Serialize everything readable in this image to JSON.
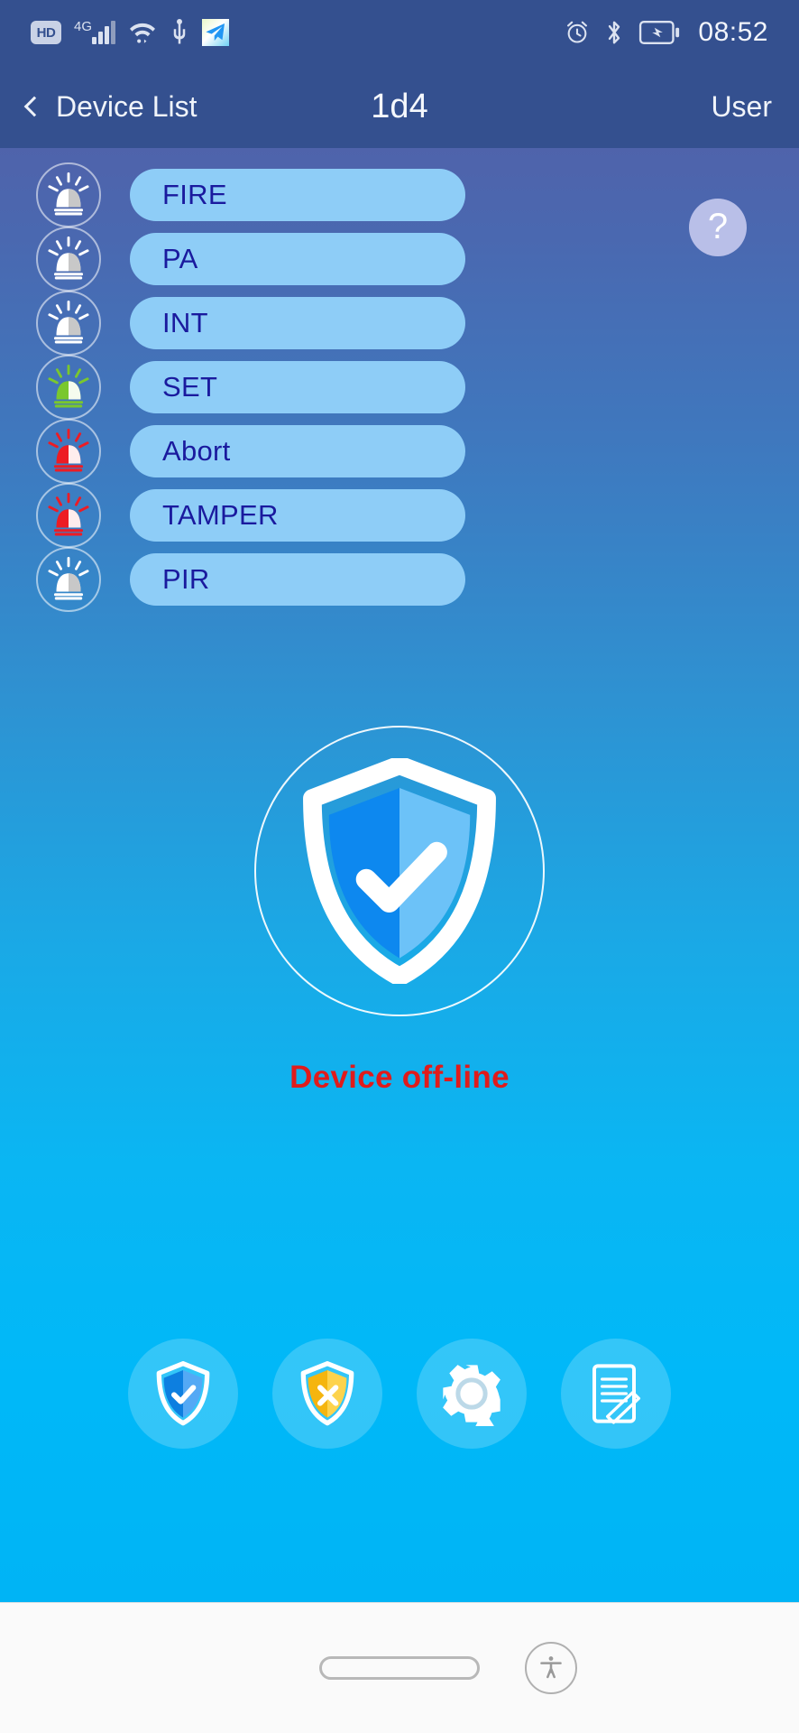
{
  "status_bar": {
    "hd_label": "HD",
    "network_label": "4G",
    "time": "08:52",
    "icons": [
      "hd-icon",
      "signal-4g-icon",
      "wifi-icon",
      "usb-icon",
      "telegram-icon",
      "alarm-clock-icon",
      "bluetooth-icon",
      "battery-charging-icon"
    ]
  },
  "header": {
    "back_label": "Device List",
    "title": "1d4",
    "user_label": "User"
  },
  "help": {
    "label": "?"
  },
  "alarms": [
    {
      "label": "FIRE",
      "siren_color": "#ffffff",
      "state": "idle"
    },
    {
      "label": "PA",
      "siren_color": "#ffffff",
      "state": "idle"
    },
    {
      "label": "INT",
      "siren_color": "#ffffff",
      "state": "idle"
    },
    {
      "label": "SET",
      "siren_color": "#7ac72e",
      "state": "active-green"
    },
    {
      "label": "Abort",
      "siren_color": "#ed1c24",
      "state": "active-red"
    },
    {
      "label": "TAMPER",
      "siren_color": "#ed1c24",
      "state": "active-red"
    },
    {
      "label": "PIR",
      "siren_color": "#ffffff",
      "state": "idle"
    }
  ],
  "hero": {
    "icon": "shield-check-icon",
    "status_text": "Device off-line",
    "status_color": "#e01b1b"
  },
  "actions": [
    {
      "name": "arm-button",
      "icon": "shield-check-icon",
      "color": "#1f8ff0"
    },
    {
      "name": "disarm-button",
      "icon": "shield-cross-icon",
      "color": "#f9c32a"
    },
    {
      "name": "settings-button",
      "icon": "gear-icon",
      "color": "#ffffff"
    },
    {
      "name": "log-button",
      "icon": "document-pen-icon",
      "color": "#ffffff"
    }
  ],
  "nav_bar": {
    "home_label": "home-pill",
    "accessibility_label": "accessibility-icon"
  },
  "colors": {
    "header_bg": "#34508f",
    "gradient_top": "#4f63ab",
    "gradient_bottom": "#00b4f5",
    "pill_bg": "#8ecdf7",
    "pill_text": "#1a1a9e",
    "help_bg": "#b9bfe8",
    "status_red": "#e01b1b"
  }
}
